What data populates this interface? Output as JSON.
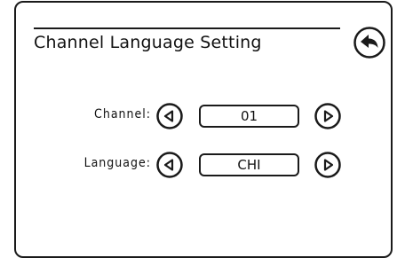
{
  "screen": {
    "title": "Channel Language Setting",
    "back_icon": "back-arrow-icon"
  },
  "settings": [
    {
      "label": "Channel:",
      "value": "01",
      "left_icon": "arrow-left-icon",
      "right_icon": "arrow-right-icon"
    },
    {
      "label": "Language:",
      "value": "CHI",
      "left_icon": "arrow-left-icon",
      "right_icon": "arrow-right-icon"
    }
  ],
  "colors": {
    "line": "#1a1a1a",
    "background": "#ffffff"
  }
}
